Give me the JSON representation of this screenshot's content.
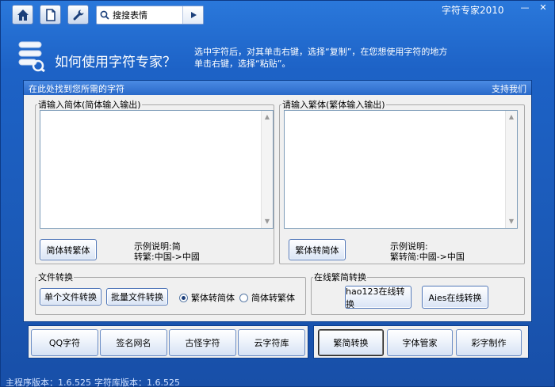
{
  "app": {
    "title": "字符专家2010",
    "window_controls": {
      "minimize": "—",
      "close": "✕"
    }
  },
  "toolbar": {
    "home_icon": "home-icon",
    "document_icon": "document-icon",
    "wrench_icon": "wrench-icon",
    "search": {
      "value": "搜搜表情",
      "icon": "search-icon",
      "go_icon": "play-icon"
    }
  },
  "banner": {
    "title": "如何使用字符专家？",
    "description_line1": "选中字符后，对其单击右键，选择“复制”，在您想使用字符的地方",
    "description_line2": "单击右键，选择“粘贴”。"
  },
  "panel": {
    "header_left": "在此处找到您所需的字符",
    "header_right": "支持我们"
  },
  "simplified_group": {
    "legend": "请输入简体(简体输入输出)",
    "text": "",
    "button": "简体转繁体",
    "example_line1": "示例说明:简",
    "example_line2": "转繁:中国->中國"
  },
  "traditional_group": {
    "legend": "请输入繁体(繁体输入输出)",
    "text": "",
    "button": "繁体转简体",
    "example_line1": "示例说明:",
    "example_line2": "繁转简:中國->中国"
  },
  "file_convert": {
    "legend": "文件转换",
    "single_button": "单个文件转换",
    "batch_button": "批量文件转换",
    "option_trad_to_simp": "繁体转简体",
    "option_simp_to_trad": "简体转繁体",
    "selected": "繁体转简体"
  },
  "online_convert": {
    "legend": "在线繁简转换",
    "hao123_button": "hao123在线转换",
    "aies_button": "Aies在线转换"
  },
  "nav_left": [
    "QQ字符",
    "签名网名",
    "古怪字符",
    "云字符库"
  ],
  "nav_right": [
    "繁简转换",
    "字体管家",
    "彩字制作"
  ],
  "status": {
    "main_version": "主程序版本：1.6.525",
    "lib_version": "字符库版本：1.6.525"
  }
}
